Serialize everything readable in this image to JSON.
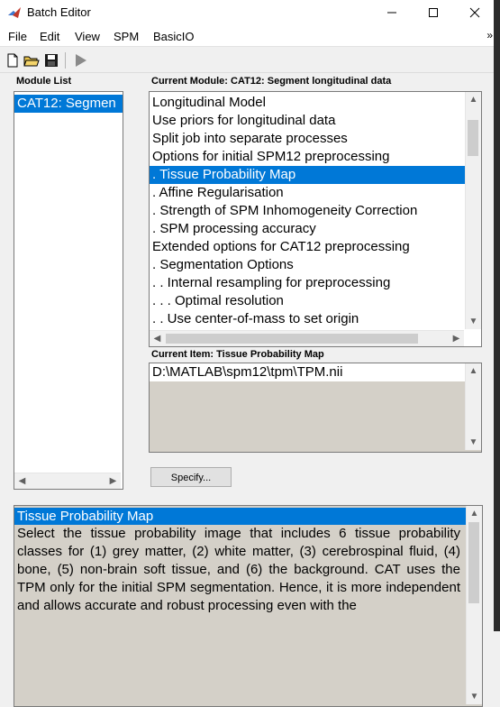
{
  "window": {
    "title": "Batch Editor",
    "minimize": "—",
    "maximize": "☐",
    "close": "✕"
  },
  "menu": {
    "items": [
      "File",
      "Edit",
      "View",
      "SPM",
      "BasicIO"
    ],
    "overflow": "»"
  },
  "toolbar": {
    "icons": [
      "new-file-icon",
      "open-folder-icon",
      "save-icon",
      "run-icon"
    ]
  },
  "module_list": {
    "label": "Module List",
    "items": [
      "CAT12: Segmen"
    ],
    "selected_index": 0
  },
  "current_module": {
    "label": "Current Module: CAT12: Segment longitudinal data",
    "items": [
      "Longitudinal Model",
      "Use priors for longitudinal data",
      "Split job into separate processes",
      "Options for initial SPM12 preprocessing",
      ". Tissue Probability Map",
      ". Affine Regularisation",
      ". Strength of SPM Inhomogeneity Correction",
      ". SPM processing accuracy",
      "Extended options for CAT12 preprocessing",
      ". Segmentation Options",
      ". . Internal resampling for preprocessing",
      ". . . Optimal resolution",
      ". . Use center-of-mass to set origin"
    ],
    "selected_index": 4
  },
  "current_item": {
    "label": "Current Item: Tissue Probability Map",
    "value": "D:\\MATLAB\\spm12\\tpm\\TPM.nii"
  },
  "specify_button": "Specify...",
  "help": {
    "title": "Tissue Probability Map",
    "body": "Select the tissue probability image that includes 6 tissue probability classes for (1) grey matter, (2) white matter, (3) cerebrospinal fluid, (4) bone, (5) non-brain soft tissue, and (6) the background. CAT uses the TPM only for the initial SPM segmentation. Hence, it is more independent and allows accurate and robust processing even with the"
  },
  "colors": {
    "selection": "#0078d7",
    "panel": "#f0f0f0",
    "readonly": "#d4d0c8"
  }
}
